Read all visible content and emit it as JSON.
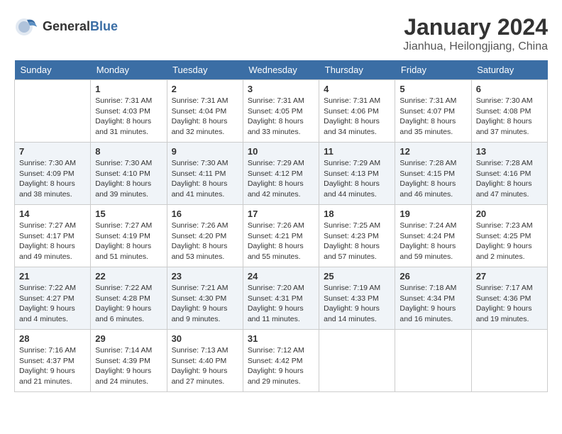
{
  "header": {
    "logo_general": "General",
    "logo_blue": "Blue",
    "title": "January 2024",
    "location": "Jianhua, Heilongjiang, China"
  },
  "days_of_week": [
    "Sunday",
    "Monday",
    "Tuesday",
    "Wednesday",
    "Thursday",
    "Friday",
    "Saturday"
  ],
  "weeks": [
    [
      {
        "day": "",
        "info": ""
      },
      {
        "day": "1",
        "info": "Sunrise: 7:31 AM\nSunset: 4:03 PM\nDaylight: 8 hours\nand 31 minutes."
      },
      {
        "day": "2",
        "info": "Sunrise: 7:31 AM\nSunset: 4:04 PM\nDaylight: 8 hours\nand 32 minutes."
      },
      {
        "day": "3",
        "info": "Sunrise: 7:31 AM\nSunset: 4:05 PM\nDaylight: 8 hours\nand 33 minutes."
      },
      {
        "day": "4",
        "info": "Sunrise: 7:31 AM\nSunset: 4:06 PM\nDaylight: 8 hours\nand 34 minutes."
      },
      {
        "day": "5",
        "info": "Sunrise: 7:31 AM\nSunset: 4:07 PM\nDaylight: 8 hours\nand 35 minutes."
      },
      {
        "day": "6",
        "info": "Sunrise: 7:30 AM\nSunset: 4:08 PM\nDaylight: 8 hours\nand 37 minutes."
      }
    ],
    [
      {
        "day": "7",
        "info": "Sunrise: 7:30 AM\nSunset: 4:09 PM\nDaylight: 8 hours\nand 38 minutes."
      },
      {
        "day": "8",
        "info": "Sunrise: 7:30 AM\nSunset: 4:10 PM\nDaylight: 8 hours\nand 39 minutes."
      },
      {
        "day": "9",
        "info": "Sunrise: 7:30 AM\nSunset: 4:11 PM\nDaylight: 8 hours\nand 41 minutes."
      },
      {
        "day": "10",
        "info": "Sunrise: 7:29 AM\nSunset: 4:12 PM\nDaylight: 8 hours\nand 42 minutes."
      },
      {
        "day": "11",
        "info": "Sunrise: 7:29 AM\nSunset: 4:13 PM\nDaylight: 8 hours\nand 44 minutes."
      },
      {
        "day": "12",
        "info": "Sunrise: 7:28 AM\nSunset: 4:15 PM\nDaylight: 8 hours\nand 46 minutes."
      },
      {
        "day": "13",
        "info": "Sunrise: 7:28 AM\nSunset: 4:16 PM\nDaylight: 8 hours\nand 47 minutes."
      }
    ],
    [
      {
        "day": "14",
        "info": "Sunrise: 7:27 AM\nSunset: 4:17 PM\nDaylight: 8 hours\nand 49 minutes."
      },
      {
        "day": "15",
        "info": "Sunrise: 7:27 AM\nSunset: 4:19 PM\nDaylight: 8 hours\nand 51 minutes."
      },
      {
        "day": "16",
        "info": "Sunrise: 7:26 AM\nSunset: 4:20 PM\nDaylight: 8 hours\nand 53 minutes."
      },
      {
        "day": "17",
        "info": "Sunrise: 7:26 AM\nSunset: 4:21 PM\nDaylight: 8 hours\nand 55 minutes."
      },
      {
        "day": "18",
        "info": "Sunrise: 7:25 AM\nSunset: 4:23 PM\nDaylight: 8 hours\nand 57 minutes."
      },
      {
        "day": "19",
        "info": "Sunrise: 7:24 AM\nSunset: 4:24 PM\nDaylight: 8 hours\nand 59 minutes."
      },
      {
        "day": "20",
        "info": "Sunrise: 7:23 AM\nSunset: 4:25 PM\nDaylight: 9 hours\nand 2 minutes."
      }
    ],
    [
      {
        "day": "21",
        "info": "Sunrise: 7:22 AM\nSunset: 4:27 PM\nDaylight: 9 hours\nand 4 minutes."
      },
      {
        "day": "22",
        "info": "Sunrise: 7:22 AM\nSunset: 4:28 PM\nDaylight: 9 hours\nand 6 minutes."
      },
      {
        "day": "23",
        "info": "Sunrise: 7:21 AM\nSunset: 4:30 PM\nDaylight: 9 hours\nand 9 minutes."
      },
      {
        "day": "24",
        "info": "Sunrise: 7:20 AM\nSunset: 4:31 PM\nDaylight: 9 hours\nand 11 minutes."
      },
      {
        "day": "25",
        "info": "Sunrise: 7:19 AM\nSunset: 4:33 PM\nDaylight: 9 hours\nand 14 minutes."
      },
      {
        "day": "26",
        "info": "Sunrise: 7:18 AM\nSunset: 4:34 PM\nDaylight: 9 hours\nand 16 minutes."
      },
      {
        "day": "27",
        "info": "Sunrise: 7:17 AM\nSunset: 4:36 PM\nDaylight: 9 hours\nand 19 minutes."
      }
    ],
    [
      {
        "day": "28",
        "info": "Sunrise: 7:16 AM\nSunset: 4:37 PM\nDaylight: 9 hours\nand 21 minutes."
      },
      {
        "day": "29",
        "info": "Sunrise: 7:14 AM\nSunset: 4:39 PM\nDaylight: 9 hours\nand 24 minutes."
      },
      {
        "day": "30",
        "info": "Sunrise: 7:13 AM\nSunset: 4:40 PM\nDaylight: 9 hours\nand 27 minutes."
      },
      {
        "day": "31",
        "info": "Sunrise: 7:12 AM\nSunset: 4:42 PM\nDaylight: 9 hours\nand 29 minutes."
      },
      {
        "day": "",
        "info": ""
      },
      {
        "day": "",
        "info": ""
      },
      {
        "day": "",
        "info": ""
      }
    ]
  ]
}
